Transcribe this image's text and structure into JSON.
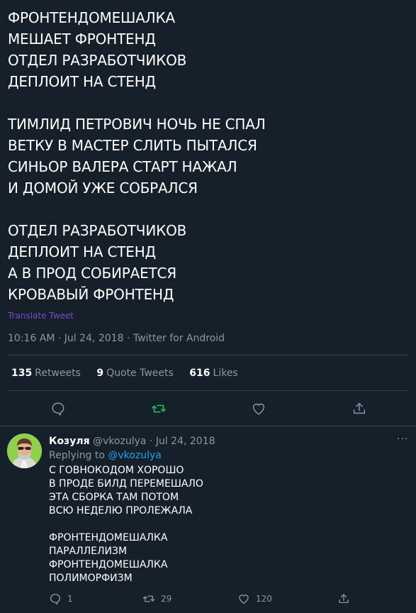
{
  "tweet": {
    "stanzas": [
      [
        "ФРОНТЕНДОМЕШАЛКА",
        "МЕШАЕТ ФРОНТЕНД",
        "ОТДЕЛ РАЗРАБОТЧИКОВ",
        "ДЕПЛОИТ НА СТЕНД"
      ],
      [
        "ТИМЛИД ПЕТРОВИЧ НОЧЬ НЕ СПАЛ",
        "ВЕТКУ В МАСТЕР СЛИТЬ ПЫТАЛСЯ",
        "СИНЬОР ВАЛЕРА СТАРТ НАЖАЛ",
        "И ДОМОЙ УЖЕ СОБРАЛСЯ"
      ],
      [
        "ОТДЕЛ РАЗРАБОТЧИКОВ",
        "ДЕПЛОИТ НА СТЕНД",
        "А В ПРОД СОБИРАЕТСЯ",
        "КРОВАВЫЙ ФРОНТЕНД"
      ]
    ],
    "translate_label": "Translate Tweet",
    "timestamp": "10:16 AM · Jul 24, 2018 · Twitter for Android",
    "stats": {
      "retweets_count": "135",
      "retweets_label": "Retweets",
      "quotes_count": "9",
      "quotes_label": "Quote Tweets",
      "likes_count": "616",
      "likes_label": "Likes"
    }
  },
  "reply": {
    "name": "Козуля",
    "handle_date": "@vkozulya · Jul 24, 2018",
    "replying_prefix": "Replying to",
    "replying_handle": "@vkozulya",
    "stanzas": [
      [
        "С ГОВНОКОДОМ ХОРОШО",
        "В ПРОДЕ БИЛД ПЕРЕМЕШАЛО",
        "ЭТА СБОРКА ТАМ ПОТОМ",
        "ВСЮ НЕДЕЛЮ ПРОЛЕЖАЛА"
      ],
      [
        "ФРОНТЕНДОМЕШАЛКА",
        "ПАРАЛЛЕЛИЗМ",
        "ФРОНТЕНДОМЕШАЛКА",
        "ПОЛИМОРФИЗМ"
      ]
    ],
    "reply_count": "1",
    "retweet_count": "29",
    "like_count": "120",
    "more_label": "···"
  },
  "colors": {
    "background": "#15202b",
    "text": "#ffffff",
    "secondary": "#8899a6",
    "divider": "#38444d",
    "retweet_active": "#17bf63",
    "link": "#1da1f2",
    "translate": "#794bc4"
  },
  "icons": [
    "comment-icon",
    "retweet-icon",
    "like-icon",
    "share-icon",
    "more-icon",
    "avatar"
  ]
}
